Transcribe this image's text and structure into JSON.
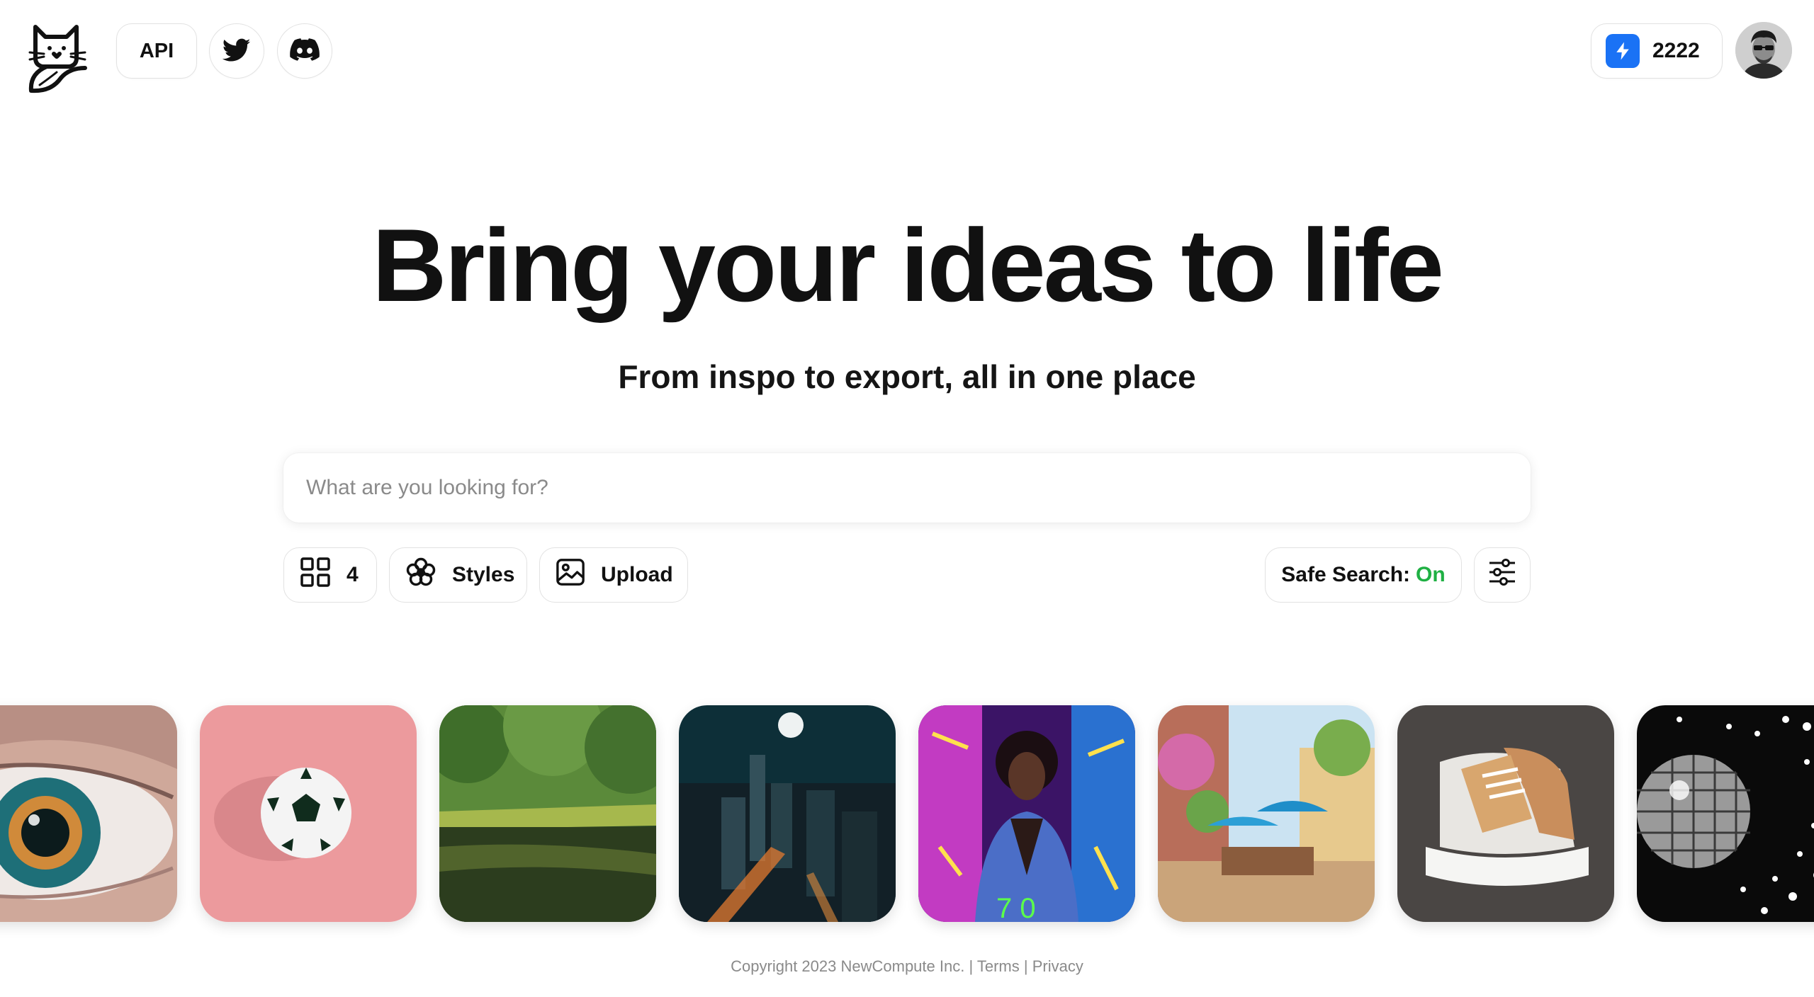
{
  "header": {
    "api_label": "API",
    "twitter_icon": "twitter-icon",
    "discord_icon": "discord-icon",
    "credits": "2222",
    "credits_icon": "lightning-bolt-icon"
  },
  "hero": {
    "title": "Bring your ideas to life",
    "subtitle": "From inspo to export, all in one place"
  },
  "search": {
    "placeholder": "What are you looking for?",
    "value": ""
  },
  "toolbar": {
    "image_count": "4",
    "styles_label": "Styles",
    "upload_label": "Upload",
    "safe_search_label": "Safe Search:",
    "safe_search_value": "On",
    "safe_search_color": "#1fb043"
  },
  "gallery": [
    {
      "subject": "eye"
    },
    {
      "subject": "soccer-ball"
    },
    {
      "subject": "forest-lake"
    },
    {
      "subject": "city-night"
    },
    {
      "subject": "neon-person"
    },
    {
      "subject": "street-cafe"
    },
    {
      "subject": "sneaker"
    },
    {
      "subject": "disco-ball"
    }
  ],
  "footer": {
    "copyright": "Copyright 2023 NewCompute Inc. | Terms | Privacy"
  },
  "colors": {
    "accent_blue": "#1a72f5",
    "safe_green": "#1fb043"
  }
}
